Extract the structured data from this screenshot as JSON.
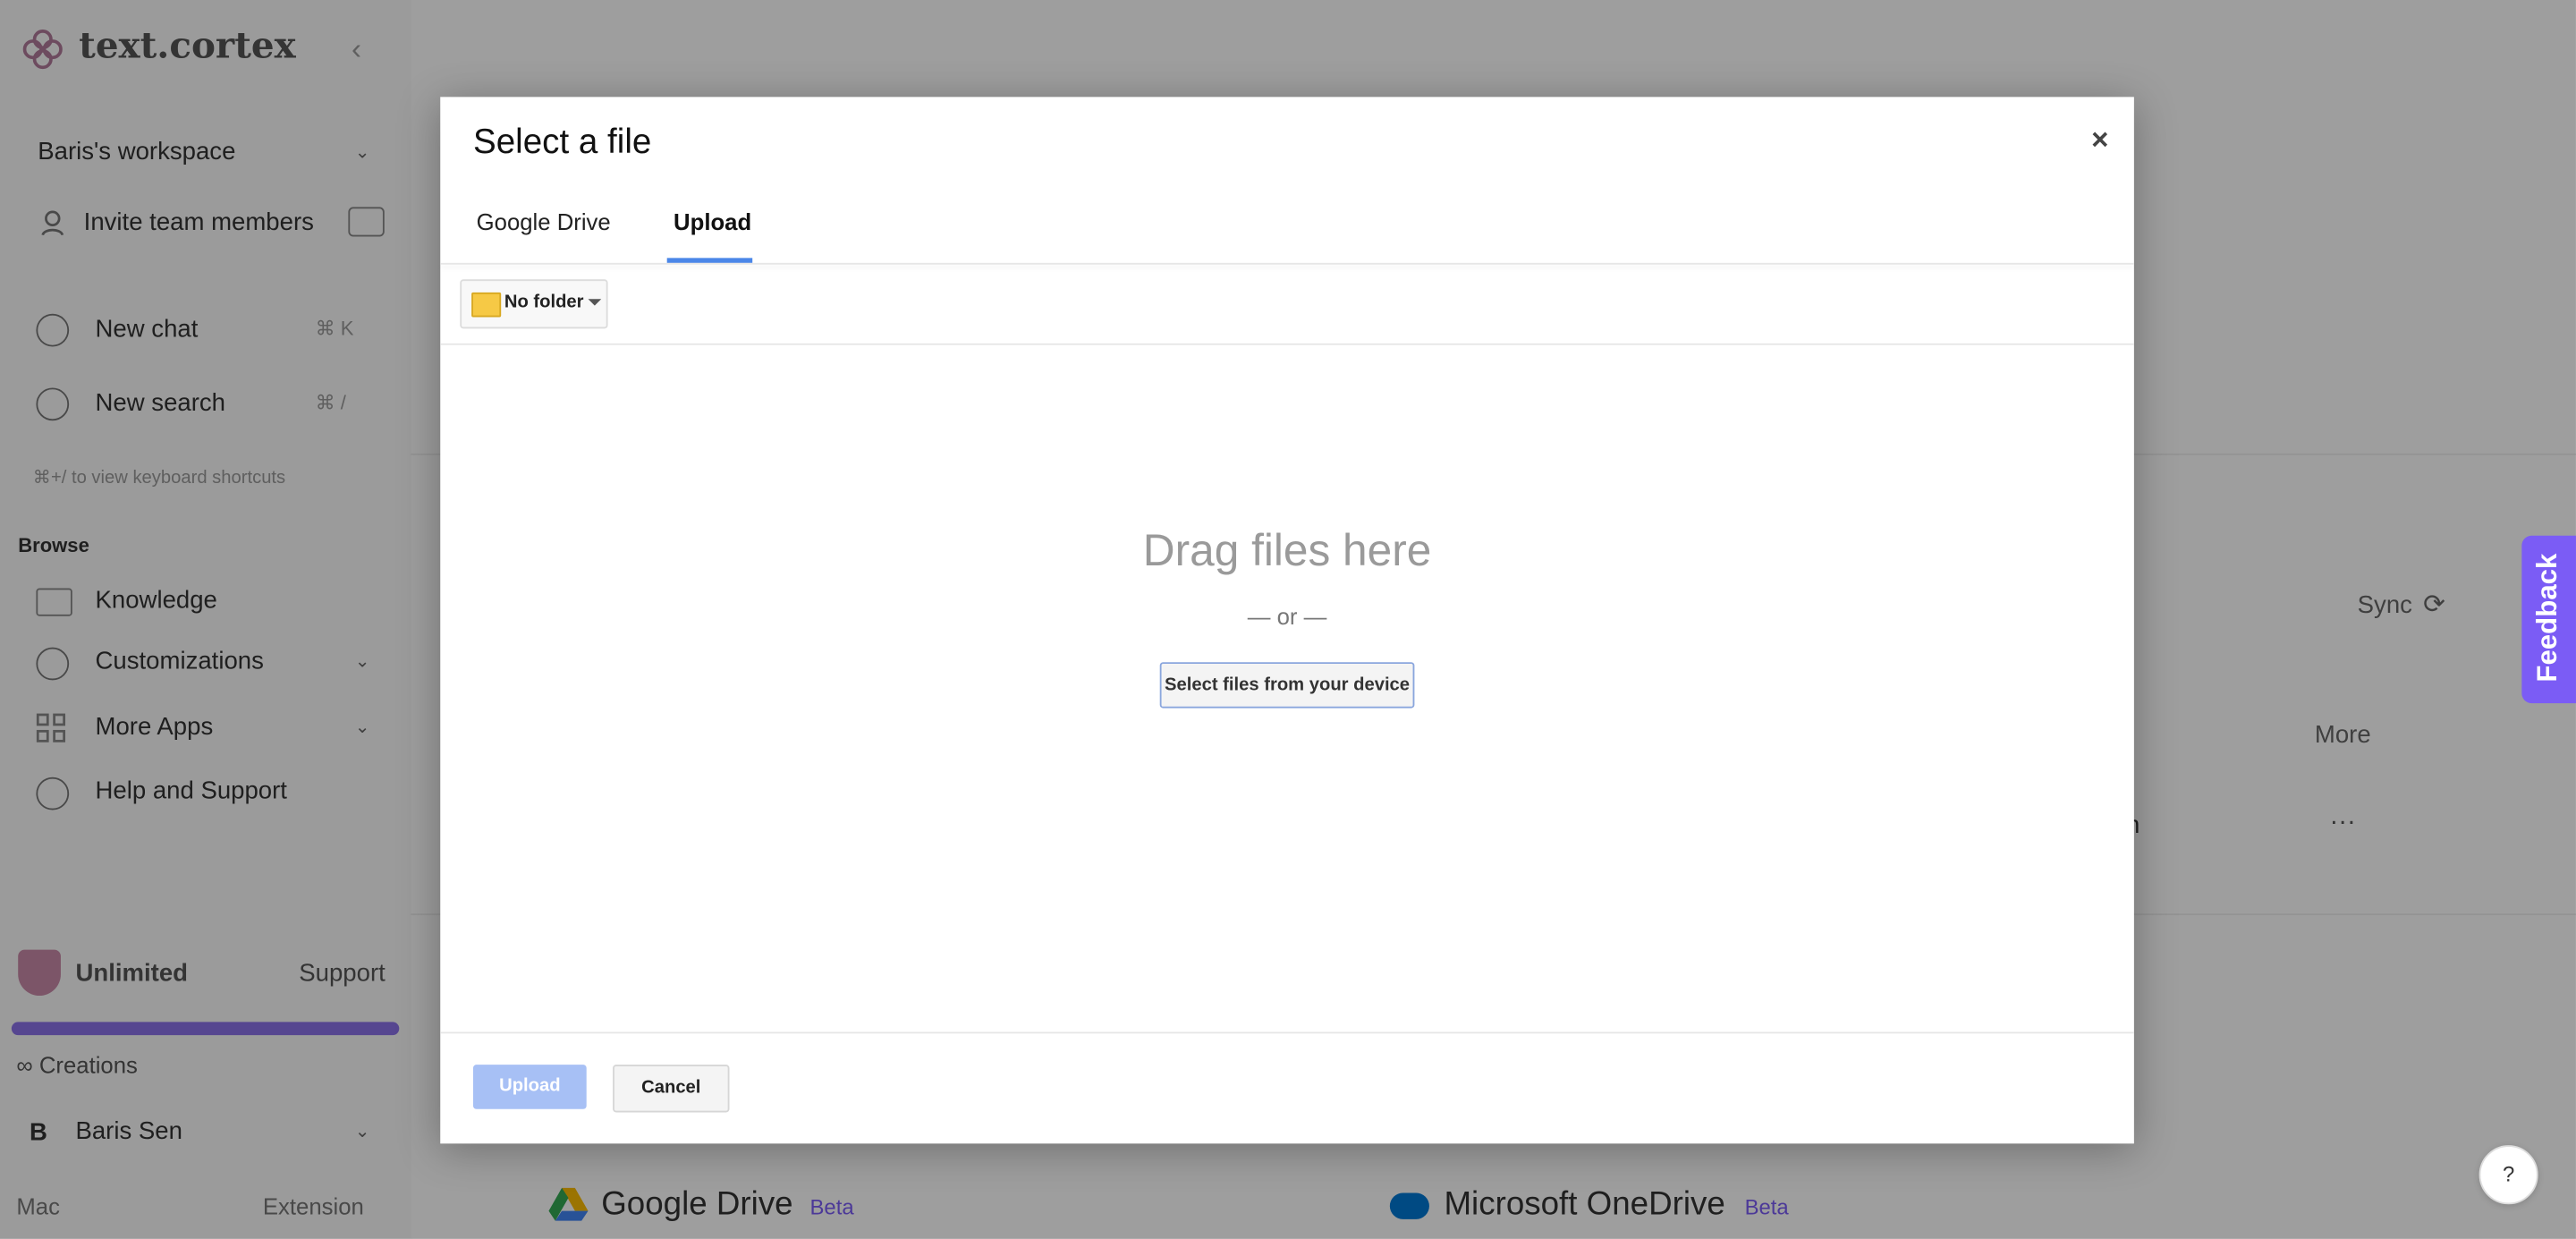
{
  "sidebar": {
    "logo_text": "text.cortex",
    "workspace": "Baris's workspace",
    "invite": "Invite team members",
    "new_chat": "New chat",
    "new_chat_shortcut": "⌘ K",
    "new_search": "New search",
    "new_search_shortcut": "⌘ /",
    "shortcuts_hint": "⌘+/ to view keyboard shortcuts",
    "browse_label": "Browse",
    "items": [
      {
        "label": "Knowledge"
      },
      {
        "label": "Customizations"
      },
      {
        "label": "More Apps"
      },
      {
        "label": "Help and Support"
      }
    ],
    "plan": "Unlimited",
    "support": "Support",
    "creations": "∞ Creations",
    "user_initial": "B",
    "user_name": "Baris Sen",
    "mac": "Mac",
    "extension": "Extension"
  },
  "main": {
    "sync": "Sync",
    "more": "More",
    "row_fragment": "m",
    "row_menu": "···",
    "integrations": [
      {
        "name": "Google Drive",
        "badge": "Beta"
      },
      {
        "name": "Microsoft OneDrive",
        "badge": "Beta"
      }
    ]
  },
  "dialog": {
    "title": "Select a file",
    "close": "×",
    "tabs": [
      {
        "label": "Google Drive"
      },
      {
        "label": "Upload"
      }
    ],
    "folder_label": "No folder",
    "drag_text": "Drag files here",
    "or_text": "— or —",
    "select_files_button": "Select files from your device",
    "upload_button": "Upload",
    "cancel_button": "Cancel"
  },
  "feedback_tab": "Feedback",
  "help_button": "?",
  "colors": {
    "accent": "#4a86e8",
    "feedback": "#7b5cf5",
    "upload_disabled": "#a7c0f5"
  }
}
